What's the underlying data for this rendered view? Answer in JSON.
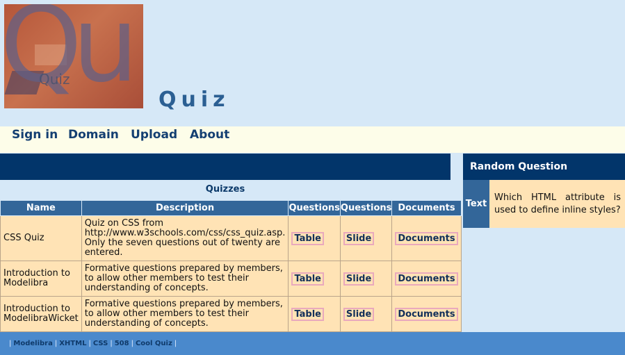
{
  "logo": {
    "text": "Quiz",
    "big_letters": "Qu"
  },
  "site_title": "Quiz",
  "nav": {
    "items": [
      {
        "label": "Sign in"
      },
      {
        "label": "Domain"
      },
      {
        "label": "Upload"
      },
      {
        "label": "About"
      }
    ]
  },
  "quizzes": {
    "heading": "Quizzes",
    "columns": [
      "Name",
      "Description",
      "Questions",
      "Questions",
      "Documents"
    ],
    "rows": [
      {
        "name": "CSS Quiz",
        "description": "Quiz on CSS from http://www.w3schools.com/css/css_quiz.asp. Only the seven questions out of twenty are entered.",
        "table_label": "Table",
        "slide_label": "Slide",
        "documents_label": "Documents"
      },
      {
        "name": "Introduction to Modelibra",
        "description": "Formative questions prepared by members, to allow other members to test their understanding of concepts.",
        "table_label": "Table",
        "slide_label": "Slide",
        "documents_label": "Documents"
      },
      {
        "name": "Introduction to ModelibraWicket",
        "description": "Formative questions prepared by members, to allow other members to test their understanding of concepts.",
        "table_label": "Table",
        "slide_label": "Slide",
        "documents_label": "Documents"
      }
    ]
  },
  "random_question": {
    "title": "Random Question",
    "type_label": "Text",
    "question": "Which HTML attribute is used to define inline styles?"
  },
  "footer": {
    "separator": "|",
    "links": [
      "Modelibra",
      "XHTML",
      "CSS",
      "508",
      "Cool Quiz"
    ]
  },
  "colors": {
    "page_bg": "#d6e8f7",
    "nav_bg": "#fdfde9",
    "dark_bar": "#02356a",
    "table_header": "#336699",
    "cell_bg": "#ffe3b5",
    "footer_bg": "#4a89cc",
    "title": "#2b5f93"
  }
}
